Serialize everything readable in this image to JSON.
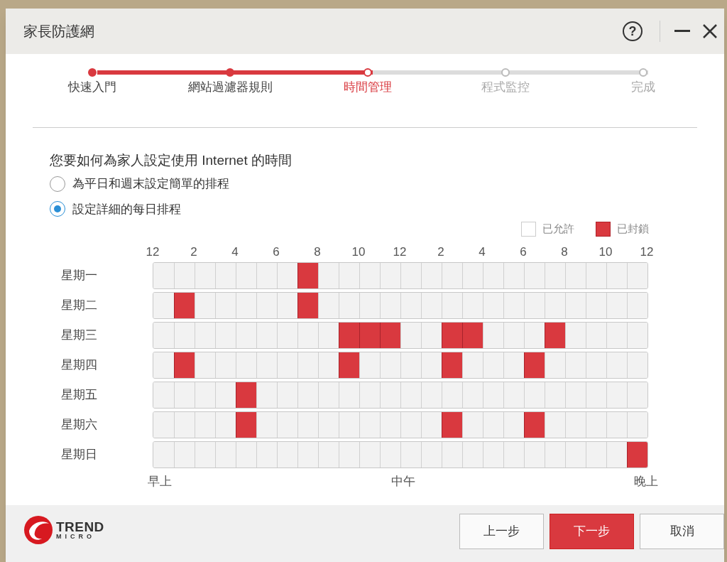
{
  "window": {
    "title": "家長防護網",
    "help_button": "?"
  },
  "steps": [
    {
      "label": "快速入門",
      "kind": "done"
    },
    {
      "label": "網站過濾器規則",
      "kind": "done"
    },
    {
      "label": "時間管理",
      "kind": "current"
    },
    {
      "label": "程式監控",
      "kind": "pending"
    },
    {
      "label": "完成",
      "kind": "pending"
    }
  ],
  "question": "您要如何為家人設定使用 Internet 的時間",
  "options": [
    {
      "label": "為平日和週末設定簡單的排程",
      "selected": false
    },
    {
      "label": "設定詳細的每日排程",
      "selected": true
    }
  ],
  "legend": [
    {
      "label": "已允許",
      "kind": "allowed"
    },
    {
      "label": "已封鎖",
      "kind": "blocked"
    }
  ],
  "schedule": {
    "hour_labels": [
      "12",
      "2",
      "4",
      "6",
      "8",
      "10",
      "12",
      "2",
      "4",
      "6",
      "8",
      "10",
      "12"
    ],
    "rows": [
      {
        "day": "星期一",
        "blocked": [
          false,
          false,
          false,
          false,
          false,
          false,
          false,
          true,
          false,
          false,
          false,
          false,
          false,
          false,
          false,
          false,
          false,
          false,
          false,
          false,
          false,
          false,
          false,
          false
        ]
      },
      {
        "day": "星期二",
        "blocked": [
          false,
          true,
          false,
          false,
          false,
          false,
          false,
          true,
          false,
          false,
          false,
          false,
          false,
          false,
          false,
          false,
          false,
          false,
          false,
          false,
          false,
          false,
          false,
          false
        ]
      },
      {
        "day": "星期三",
        "blocked": [
          false,
          false,
          false,
          false,
          false,
          false,
          false,
          false,
          false,
          true,
          true,
          true,
          false,
          false,
          true,
          true,
          false,
          false,
          false,
          true,
          false,
          false,
          false,
          false
        ]
      },
      {
        "day": "星期四",
        "blocked": [
          false,
          true,
          false,
          false,
          false,
          false,
          false,
          false,
          false,
          true,
          false,
          false,
          false,
          false,
          true,
          false,
          false,
          false,
          true,
          false,
          false,
          false,
          false,
          false
        ]
      },
      {
        "day": "星期五",
        "blocked": [
          false,
          false,
          false,
          false,
          true,
          false,
          false,
          false,
          false,
          false,
          false,
          false,
          false,
          false,
          false,
          false,
          false,
          false,
          false,
          false,
          false,
          false,
          false,
          false
        ]
      },
      {
        "day": "星期六",
        "blocked": [
          false,
          false,
          false,
          false,
          true,
          false,
          false,
          false,
          false,
          false,
          false,
          false,
          false,
          false,
          true,
          false,
          false,
          false,
          true,
          false,
          false,
          false,
          false,
          false
        ]
      },
      {
        "day": "星期日",
        "blocked": [
          false,
          false,
          false,
          false,
          false,
          false,
          false,
          false,
          false,
          false,
          false,
          false,
          false,
          false,
          false,
          false,
          false,
          false,
          false,
          false,
          false,
          false,
          false,
          true
        ]
      }
    ],
    "period_labels": [
      "早上",
      "中午",
      "晚上"
    ]
  },
  "logo": {
    "line_1": "TREND",
    "line_2": "MICRO"
  },
  "buttons": [
    {
      "label": "上一步",
      "kind": "secondary"
    },
    {
      "label": "下一步",
      "kind": "primary"
    },
    {
      "label": "取消",
      "kind": "secondary"
    }
  ]
}
